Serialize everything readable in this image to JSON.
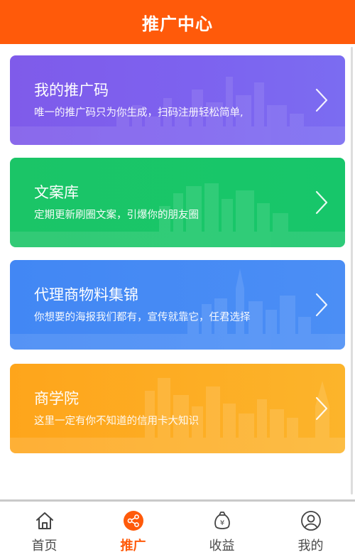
{
  "header": {
    "title": "推广中心"
  },
  "cards": [
    {
      "title": "我的推广码",
      "subtitle": "唯一的推广码只为你生成，扫码注册轻松简单,",
      "color": "#7f5bea"
    },
    {
      "title": "文案库",
      "subtitle": "定期更新刷圈文案，引爆你的朋友圈",
      "color": "#1bc567"
    },
    {
      "title": "代理商物料集锦",
      "subtitle": "你想要的海报我们都有，宣传就靠它，任君选择",
      "color": "#4287f4"
    },
    {
      "title": "商学院",
      "subtitle": "这里一定有你不知道的信用卡大知识",
      "color": "#fea51b"
    }
  ],
  "tabbar": {
    "active_color": "#ff5a0a",
    "items": [
      {
        "label": "首页",
        "icon": "home-icon"
      },
      {
        "label": "推广",
        "icon": "share-icon",
        "active": true
      },
      {
        "label": "收益",
        "icon": "money-bag-icon"
      },
      {
        "label": "我的",
        "icon": "user-icon"
      }
    ]
  }
}
